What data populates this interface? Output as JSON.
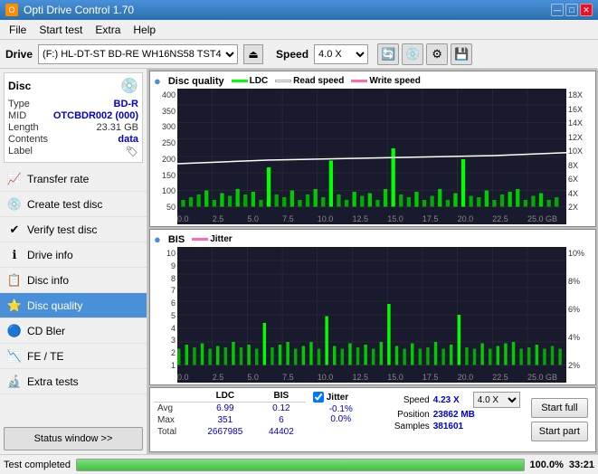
{
  "app": {
    "title": "Opti Drive Control 1.70",
    "icon": "O"
  },
  "titlebar": {
    "minimize": "—",
    "maximize": "□",
    "close": "✕"
  },
  "menu": {
    "items": [
      "File",
      "Start test",
      "Extra",
      "Help"
    ]
  },
  "drive_bar": {
    "label": "Drive",
    "drive_value": "(F:)  HL-DT-ST BD-RE  WH16NS58 TST4",
    "speed_label": "Speed",
    "speed_value": "4.0 X",
    "eject_icon": "⏏"
  },
  "disc": {
    "title": "Disc",
    "type_label": "Type",
    "type_val": "BD-R",
    "mid_label": "MID",
    "mid_val": "OTCBDR002 (000)",
    "length_label": "Length",
    "length_val": "23.31 GB",
    "contents_label": "Contents",
    "contents_val": "data",
    "label_label": "Label",
    "label_val": ""
  },
  "nav": {
    "items": [
      {
        "id": "transfer-rate",
        "label": "Transfer rate",
        "icon": "📈"
      },
      {
        "id": "create-test-disc",
        "label": "Create test disc",
        "icon": "💿"
      },
      {
        "id": "verify-test-disc",
        "label": "Verify test disc",
        "icon": "✔"
      },
      {
        "id": "drive-info",
        "label": "Drive info",
        "icon": "ℹ"
      },
      {
        "id": "disc-info",
        "label": "Disc info",
        "icon": "📋"
      },
      {
        "id": "disc-quality",
        "label": "Disc quality",
        "icon": "⭐",
        "active": true
      },
      {
        "id": "cd-bler",
        "label": "CD Bler",
        "icon": "🔵"
      },
      {
        "id": "fe-te",
        "label": "FE / TE",
        "icon": "📉"
      },
      {
        "id": "extra-tests",
        "label": "Extra tests",
        "icon": "🔬"
      }
    ]
  },
  "status_btn": "Status window >>",
  "chart1": {
    "title": "Disc quality",
    "legend": [
      {
        "label": "LDC",
        "color": "#00ff00"
      },
      {
        "label": "Read speed",
        "color": "#ffffff"
      },
      {
        "label": "Write speed",
        "color": "#ff69b4"
      }
    ],
    "y_left": [
      "400",
      "350",
      "300",
      "250",
      "200",
      "150",
      "100",
      "50"
    ],
    "y_right": [
      "18X",
      "16X",
      "14X",
      "12X",
      "10X",
      "8X",
      "6X",
      "4X",
      "2X"
    ],
    "x_labels": [
      "0.0",
      "2.5",
      "5.0",
      "7.5",
      "10.0",
      "12.5",
      "15.0",
      "17.5",
      "20.0",
      "22.5",
      "25.0 GB"
    ]
  },
  "chart2": {
    "title": "BIS",
    "legend2": [
      {
        "label": "Jitter",
        "color": "#ff69b4"
      }
    ],
    "y_left": [
      "10",
      "9",
      "8",
      "7",
      "6",
      "5",
      "4",
      "3",
      "2",
      "1"
    ],
    "y_right": [
      "10%",
      "8%",
      "6%",
      "4%",
      "2%"
    ],
    "x_labels": [
      "0.0",
      "2.5",
      "5.0",
      "7.5",
      "10.0",
      "12.5",
      "15.0",
      "17.5",
      "20.0",
      "22.5",
      "25.0 GB"
    ]
  },
  "stats": {
    "headers": [
      "LDC",
      "BIS"
    ],
    "rows": [
      {
        "label": "Avg",
        "ldc": "6.99",
        "bis": "0.12"
      },
      {
        "label": "Max",
        "ldc": "351",
        "bis": "6"
      },
      {
        "label": "Total",
        "ldc": "2667985",
        "bis": "44402"
      }
    ],
    "jitter": {
      "checked": true,
      "label": "Jitter",
      "avg": "-0.1%",
      "max": "0.0%",
      "empty": ""
    },
    "speed": {
      "label": "Speed",
      "val": "4.23 X",
      "val2": "4.0 X"
    },
    "position": {
      "label": "Position",
      "val": "23862 MB"
    },
    "samples": {
      "label": "Samples",
      "val": "381601"
    },
    "buttons": {
      "start_full": "Start full",
      "start_part": "Start part"
    }
  },
  "progress": {
    "fill_pct": "100%",
    "text": "100.0%",
    "time": "33:21",
    "status": "Test completed"
  }
}
